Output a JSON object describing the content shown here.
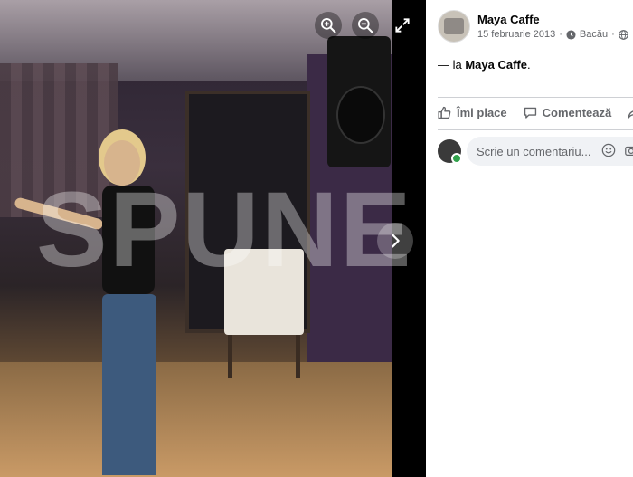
{
  "viewer": {
    "watermark": "SPUNE",
    "zoom_in_icon": "zoom-in-icon",
    "zoom_out_icon": "zoom-out-icon",
    "fullscreen_icon": "fullscreen-icon",
    "next_icon": "chevron-right-icon"
  },
  "post": {
    "author": "Maya Caffe",
    "date": "15 februarie 2013",
    "separator": "·",
    "location": "Bacău",
    "text_prefix": "— la ",
    "text_place": "Maya Caffe",
    "text_suffix": "."
  },
  "actions": {
    "like_label": "Îmi place",
    "comment_label": "Comentează",
    "share_icon": "share-icon"
  },
  "comment_box": {
    "placeholder": "Scrie un comentariu..."
  },
  "colors": {
    "text_primary": "#050505",
    "text_secondary": "#65676b",
    "online": "#31a24c",
    "input_bg": "#f0f2f5"
  }
}
